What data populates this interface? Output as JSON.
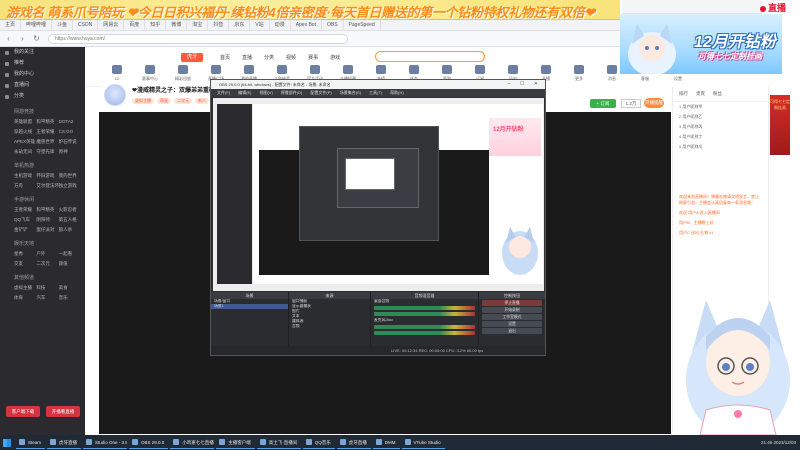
{
  "banner": {
    "text": "游戏名 萌系爪号陪玩 ❤今日日积兴福丹·续钻粉4倍亲密度·每天首日赠送的第一个钻粉特权礼物还有双倍❤"
  },
  "browser": {
    "tabs": [
      "主页",
      "哔哩哔哩",
      "斗鱼",
      "CSDN",
      "网易云",
      "百度",
      "知乎",
      "微博",
      "淘宝",
      "抖音",
      "京东",
      "V站",
      "动漫",
      "Apex Bot",
      "OBS",
      "PageSpeed"
    ],
    "url": "https://www.huya.com/"
  },
  "sidebar": {
    "items": [
      {
        "label": "我的关注"
      },
      {
        "label": "推荐"
      },
      {
        "label": "我的中心"
      },
      {
        "label": "直播间"
      },
      {
        "label": "分类"
      }
    ],
    "sections": [
      {
        "head": "网游竞技",
        "cells": [
          "英雄联盟",
          "和平精英",
          "DOTA2",
          "穿越火线",
          "王者荣耀",
          "CS:GO",
          "APEX英雄",
          "魔兽世界",
          "炉石传说",
          "永劫无间",
          "守望先锋",
          "原神"
        ]
      },
      {
        "head": "单机热游",
        "cells": [
          "主机游戏",
          "怀旧游戏",
          "我的世界",
          "方舟",
          "艾尔登法环",
          "独立游戏"
        ]
      },
      {
        "head": "手游休闲",
        "cells": [
          "王者荣耀",
          "和平精英",
          "火影忍者",
          "QQ飞车",
          "阴阳师",
          "第五人格",
          "金铲铲",
          "蛋仔派对",
          "狼人杀"
        ]
      },
      {
        "head": "娱乐天地",
        "cells": [
          "星秀",
          "户外",
          "一起看",
          "交友",
          "二次元",
          "颜值"
        ]
      },
      {
        "head": "其他频道",
        "cells": [
          "虚拟主播",
          "科技",
          "美食",
          "体育",
          "汽车",
          "音乐"
        ]
      }
    ],
    "bottom_buttons": [
      "客户端下载",
      "开播看直播"
    ]
  },
  "site": {
    "logo": "虎牙",
    "links": [
      "首页",
      "直播",
      "分类",
      "视频",
      "赛事",
      "游戏"
    ],
    "icons": [
      "12",
      "赛事中心",
      "精彩回放",
      "直播广场",
      "我的直播",
      "斗鱼抽奖",
      "官方活动",
      "主播招募",
      "充值",
      "任务",
      "签到",
      "订阅",
      "历史",
      "开播",
      "更多",
      "消息",
      "客服",
      "设置"
    ]
  },
  "streamer": {
    "title": "❤漫威精灵之子：双爆弟弟重磅",
    "tags": [
      "虚拟主播",
      "萌宠",
      "二次元",
      "新人"
    ],
    "follow_label": "+ 订阅",
    "follow_count": "1.2万",
    "cta": "开播提醒"
  },
  "obs": {
    "title": "OBS 29.0.0 (64-bit, windows) - 配置文件: 未命名 - 场景: 未命名",
    "menu": [
      "文件(F)",
      "编辑(E)",
      "视图(V)",
      "停靠部件(D)",
      "配置文件(P)",
      "场景集合(S)",
      "工具(T)",
      "帮助(H)"
    ],
    "docks": {
      "scenes_head": "场景",
      "scenes": [
        "场景/窗口",
        "场景1"
      ],
      "sources_head": "来源",
      "sources": [
        "窗口捕获",
        "显示器捕获",
        "图片",
        "文本",
        "媒体源",
        "音频"
      ],
      "mixer_head": "音频混音器",
      "mixer": [
        "桌面音频",
        "麦克风/Aux"
      ],
      "controls_head": "控制按钮",
      "controls": [
        "停止直播",
        "开始录制",
        "工作室模式",
        "设置",
        "退出"
      ]
    },
    "status": "LIVE: 00:12:34   REC: 00:00:00   CPU: 3.2%  60.00 fps"
  },
  "right_panel": {
    "tabs": [
      "排行",
      "贵宾",
      "粉丝"
    ],
    "rows": [
      "1 用户昵称甲",
      "2 用户昵称乙",
      "3 用户昵称丙",
      "4 用户昵称丁",
      "5 用户昵称戊"
    ],
    "chat": [
      "欢迎来到直播间！弹幕礼物请文明发言，禁止刷屏引战，主播会认真回复每一条消息哦~",
      "欢迎 用户A 进入直播间",
      "用户B：主播晚上好",
      "用户C 送出 礼物 x1"
    ]
  },
  "promo": {
    "big": "12月开钻粉",
    "small": "可得七七定制挂画"
  },
  "live_badge": "直播",
  "taskbar": {
    "items": [
      "Steam",
      "虎牙直播",
      "Studio One - 3.5",
      "OBS 29.0.0",
      "小鸡崽七七直播",
      "主播客户端",
      "高土飞·直播间",
      "QQ音乐",
      "虎牙直播",
      "DMM",
      "VTube Studio"
    ],
    "tray": "21:45  2023/12/03"
  },
  "colors": {
    "accent": "#ff8c1a",
    "brand": "#ff5b3a",
    "live": "#e8112d"
  }
}
